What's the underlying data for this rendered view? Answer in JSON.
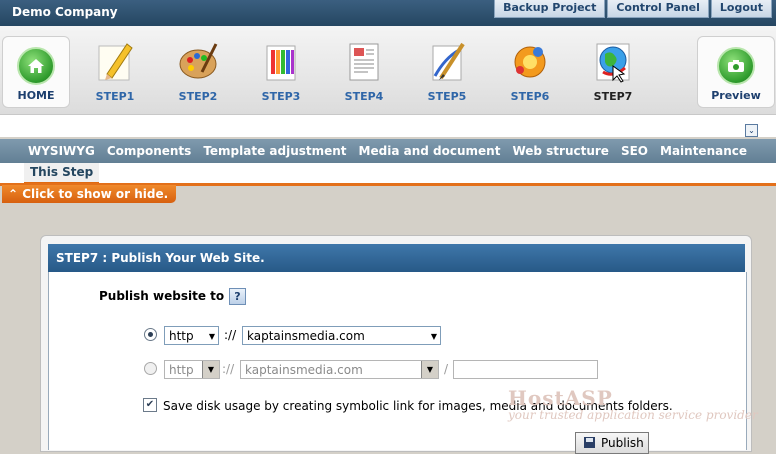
{
  "topbar": {
    "company": "Demo Company",
    "links": [
      "Backup Project",
      "Control Panel",
      "Logout"
    ]
  },
  "steps": {
    "home_label": "HOME",
    "preview_label": "Preview",
    "items": [
      {
        "label": "STEP1",
        "icon": "pencil-icon"
      },
      {
        "label": "STEP2",
        "icon": "palette-icon"
      },
      {
        "label": "STEP3",
        "icon": "color-swatches-icon"
      },
      {
        "label": "STEP4",
        "icon": "document-icon"
      },
      {
        "label": "STEP5",
        "icon": "brush-icon"
      },
      {
        "label": "STEP6",
        "icon": "gear-flower-icon"
      },
      {
        "label": "STEP7",
        "icon": "globe-icon"
      }
    ],
    "current": "STEP7"
  },
  "tabs": [
    "WYSIWYG",
    "Components",
    "Template adjustment",
    "Media and document",
    "Web structure",
    "SEO",
    "Maintenance"
  ],
  "subtab": "This Step",
  "toggle_bar": "Click to show or hide.",
  "panel": {
    "title": "STEP7 : Publish Your Web Site.",
    "publish_label": "Publish website to :",
    "help": "?",
    "row1": {
      "protocol": "http",
      "sep": "://",
      "domain": "kaptainsmedia.com",
      "selected": true
    },
    "row2": {
      "protocol": "http",
      "sep": "://",
      "domain": "kaptainsmedia.com",
      "slash": "/",
      "path": "",
      "selected": false
    },
    "checkbox_label": "Save disk usage by creating symbolic link for images, media and documents folders.",
    "checkbox_checked": true,
    "publish_button": "Publish"
  },
  "watermark": {
    "line1": "HostASP",
    "line2": "your trusted application service provider"
  },
  "colors": {
    "topbar": "#2c506f",
    "tabbar": "#6f8aa0",
    "accent_orange": "#e3701a",
    "panel_header": "#326a9c"
  }
}
